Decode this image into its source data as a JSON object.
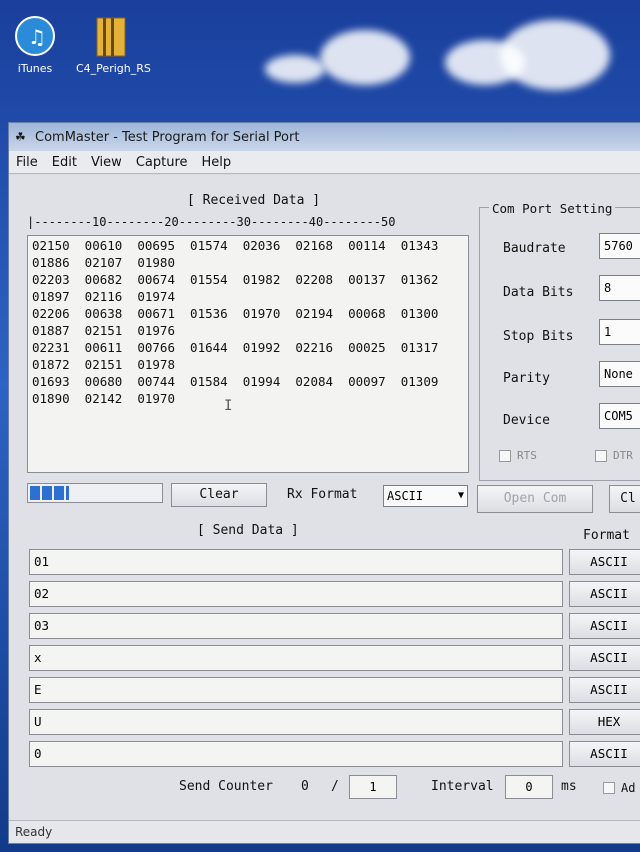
{
  "desktop": {
    "icons": [
      {
        "label": "iTunes",
        "icon": "itunes-icon"
      },
      {
        "label": "C4_Perigh_RS",
        "icon": "folder-icon"
      }
    ]
  },
  "window": {
    "title": "ComMaster - Test Program for Serial Port",
    "menu": [
      "File",
      "Edit",
      "View",
      "Capture",
      "Help"
    ]
  },
  "received": {
    "title": "[ Received Data ]",
    "ruler": "|--------10--------20--------30--------40--------50",
    "lines": [
      "02150  00610  00695  01574  02036  02168  00114  01343",
      "01886  02107  01980",
      "02203  00682  00674  01554  01982  02208  00137  01362",
      "01897  02116  01974",
      "02206  00638  00671  01536  01970  02194  00068  01300",
      "01887  02151  01976",
      "02231  00611  00766  01644  01992  02216  00025  01317",
      "01872  02151  01978",
      "01693  00680  00744  01584  01994  02084  00097  01309",
      "01890  02142  01970"
    ]
  },
  "comport": {
    "title": "Com Port Setting",
    "baudrate_label": "Baudrate",
    "baudrate": "5760",
    "databits_label": "Data Bits",
    "databits": "8",
    "stopbits_label": "Stop Bits",
    "stopbits": "1",
    "parity_label": "Parity",
    "parity": "None",
    "device_label": "Device",
    "device": "COM5",
    "rts_label": "RTS",
    "dtr_label": "DTR"
  },
  "controls": {
    "progress": 0.3,
    "clear_label": "Clear",
    "rx_format_label": "Rx Format",
    "rx_format": "ASCII",
    "open_label": "Open Com",
    "close_label": "Cl"
  },
  "send": {
    "title": "[ Send Data ]",
    "format_title": "Format",
    "rows": [
      {
        "value": "01",
        "format": "ASCII"
      },
      {
        "value": "02",
        "format": "ASCII"
      },
      {
        "value": "03",
        "format": "ASCII"
      },
      {
        "value": "x",
        "format": "ASCII"
      },
      {
        "value": "E",
        "format": "ASCII"
      },
      {
        "value": "U",
        "format": "HEX"
      },
      {
        "value": "0",
        "format": "ASCII"
      }
    ]
  },
  "counter": {
    "label": "Send Counter",
    "current": "0",
    "separator": "/",
    "total": "1",
    "interval_label": "Interval",
    "interval": "0",
    "unit": "ms",
    "ad_label": "Ad"
  },
  "status": {
    "text": "Ready"
  }
}
